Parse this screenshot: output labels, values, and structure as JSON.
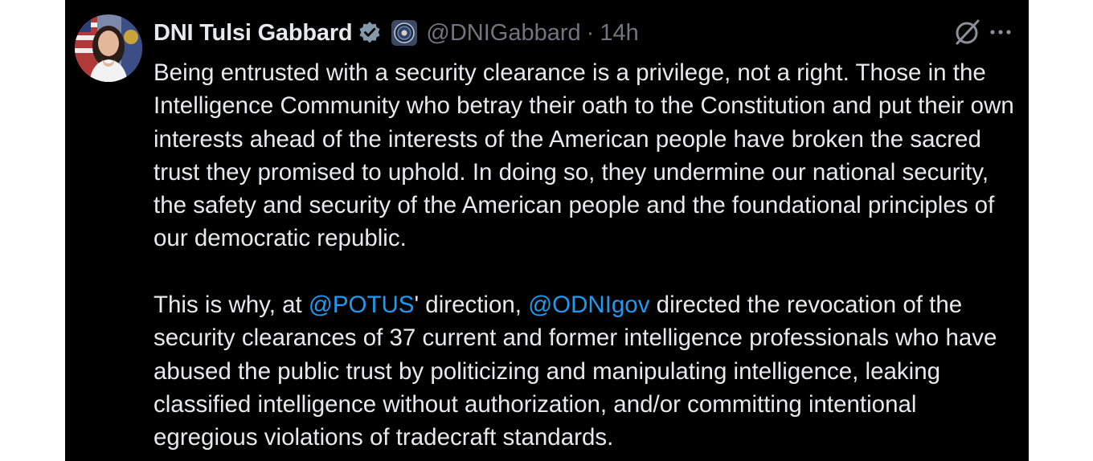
{
  "tweet": {
    "display_name": "DNI Tulsi Gabbard",
    "handle": "@DNIGabbard",
    "separator": "·",
    "time": "14h",
    "paragraph1": "Being entrusted with a security clearance is a privilege, not a right. Those in the Intelligence Community who betray their oath to the Constitution and put their own interests ahead of the interests of the American people have broken the sacred trust they promised to uphold. In doing so, they undermine our national security, the safety and security of the American people and the foundational principles of our democratic republic.",
    "paragraph2": {
      "part1": "This is why, at ",
      "mention1": "@POTUS",
      "part2": "' direction, ",
      "mention2": "@ODNIgov",
      "part3": " directed the revocation of the security clearances of 37 current and former intelligence professionals who have abused the public trust by politicizing and manipulating intelligence, leaking classified intelligence without authorization, and/or committing intentional egregious violations of tradecraft standards."
    }
  },
  "icons": {
    "avatar": "profile-photo",
    "verified": "verified-badge-icon",
    "affiliation": "odni-seal-icon",
    "grok": "grok-icon",
    "more": "more-icon"
  },
  "colors": {
    "background": "#000000",
    "text": "#e7e9ea",
    "secondary": "#71767b",
    "link": "#1d9bf0"
  }
}
